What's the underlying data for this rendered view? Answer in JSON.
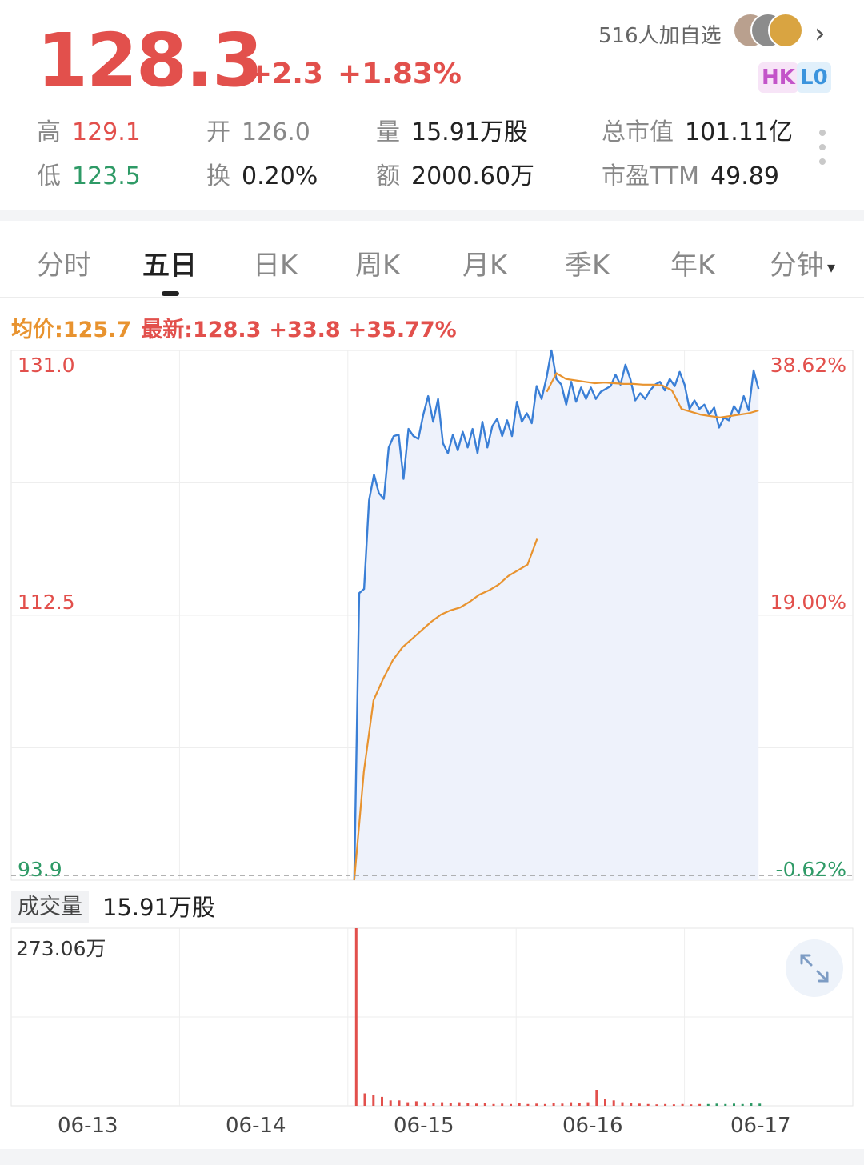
{
  "quote": {
    "price": "128.3",
    "change": "+2.3",
    "change_pct": "+1.83%",
    "followers": "516人加自选",
    "badges": [
      "HK",
      "L0"
    ]
  },
  "stats": {
    "high": {
      "label": "高",
      "value": "129.1"
    },
    "low": {
      "label": "低",
      "value": "123.5"
    },
    "open": {
      "label": "开",
      "value": "126.0"
    },
    "turnover_rate": {
      "label": "换",
      "value": "0.20%"
    },
    "volume": {
      "label": "量",
      "value": "15.91万股"
    },
    "amount": {
      "label": "额",
      "value": "2000.60万"
    },
    "market_cap": {
      "label": "总市值",
      "value": "101.11亿"
    },
    "pe_ttm": {
      "label": "市盈TTM",
      "value": "49.89"
    }
  },
  "tabs": [
    "分时",
    "五日",
    "日K",
    "周K",
    "月K",
    "季K",
    "年K",
    "分钟"
  ],
  "active_tab": "五日",
  "legend": {
    "avg": "均价:125.7",
    "latest": "最新:128.3",
    "delta": "+33.8",
    "delta_pct": "+35.77%"
  },
  "volume_section": {
    "title": "成交量",
    "value": "15.91万股",
    "max_label": "273.06万"
  },
  "colors": {
    "up": "#e2504c",
    "down": "#2e9a66",
    "price_line": "#3a7fd6",
    "avg_line": "#e8932f",
    "area_fill": "#eef2fb"
  },
  "chart_data": {
    "type": "line",
    "x": [
      "06-13",
      "06-14",
      "06-15",
      "06-16",
      "06-17"
    ],
    "y_ticks_left": [
      "131.0",
      "112.5",
      "93.9"
    ],
    "y_ticks_right": [
      "38.62%",
      "19.00%",
      "-0.62%"
    ],
    "ylim": [
      93.9,
      131.0
    ],
    "series": [
      {
        "values": [
          93.9,
          114.0,
          114.3,
          120.5,
          122.3,
          121.0,
          120.6,
          124.2,
          125.0,
          125.1,
          122.0,
          125.5,
          125.0,
          124.8,
          126.5,
          127.8,
          126.0,
          127.6,
          124.5,
          123.8,
          125.1,
          124.0,
          125.3,
          124.2,
          125.5,
          123.8,
          126.0,
          124.2,
          125.7,
          126.2,
          125.0,
          126.1,
          125.0,
          127.4,
          126.0,
          126.6,
          125.9,
          128.5,
          127.6,
          129.1,
          131.0,
          129.0,
          128.6,
          127.2,
          128.8,
          127.4,
          128.4,
          127.6,
          128.4,
          127.6,
          128.1,
          128.3,
          128.5,
          129.3,
          128.6,
          130.0,
          129.0,
          127.5,
          128.0,
          127.6,
          128.2,
          128.6,
          128.8,
          128.2,
          129.0,
          128.5,
          129.5,
          128.6,
          126.9,
          127.5,
          126.9,
          127.2,
          126.5,
          127.0,
          125.6,
          126.3,
          126.1,
          127.1,
          126.6,
          127.8,
          126.8,
          129.6,
          128.3
        ]
      },
      {
        "values": [
          93.9,
          101.5,
          106.5,
          108.0,
          109.3,
          110.2,
          110.8,
          111.4,
          112.0,
          112.5,
          112.8,
          113.0,
          113.4,
          113.9,
          114.2,
          114.6,
          115.2,
          115.6,
          116.0,
          117.8,
          128.1,
          129.4,
          129.0,
          128.9,
          128.8,
          128.7,
          128.75,
          128.7,
          128.65,
          128.65,
          128.6,
          128.6,
          128.55,
          128.2,
          126.9,
          126.7,
          126.5,
          126.4,
          126.3,
          126.4,
          126.5,
          126.6,
          126.8
        ]
      }
    ],
    "volume": {
      "max": "273.06万",
      "peak_day": "06-14"
    }
  }
}
